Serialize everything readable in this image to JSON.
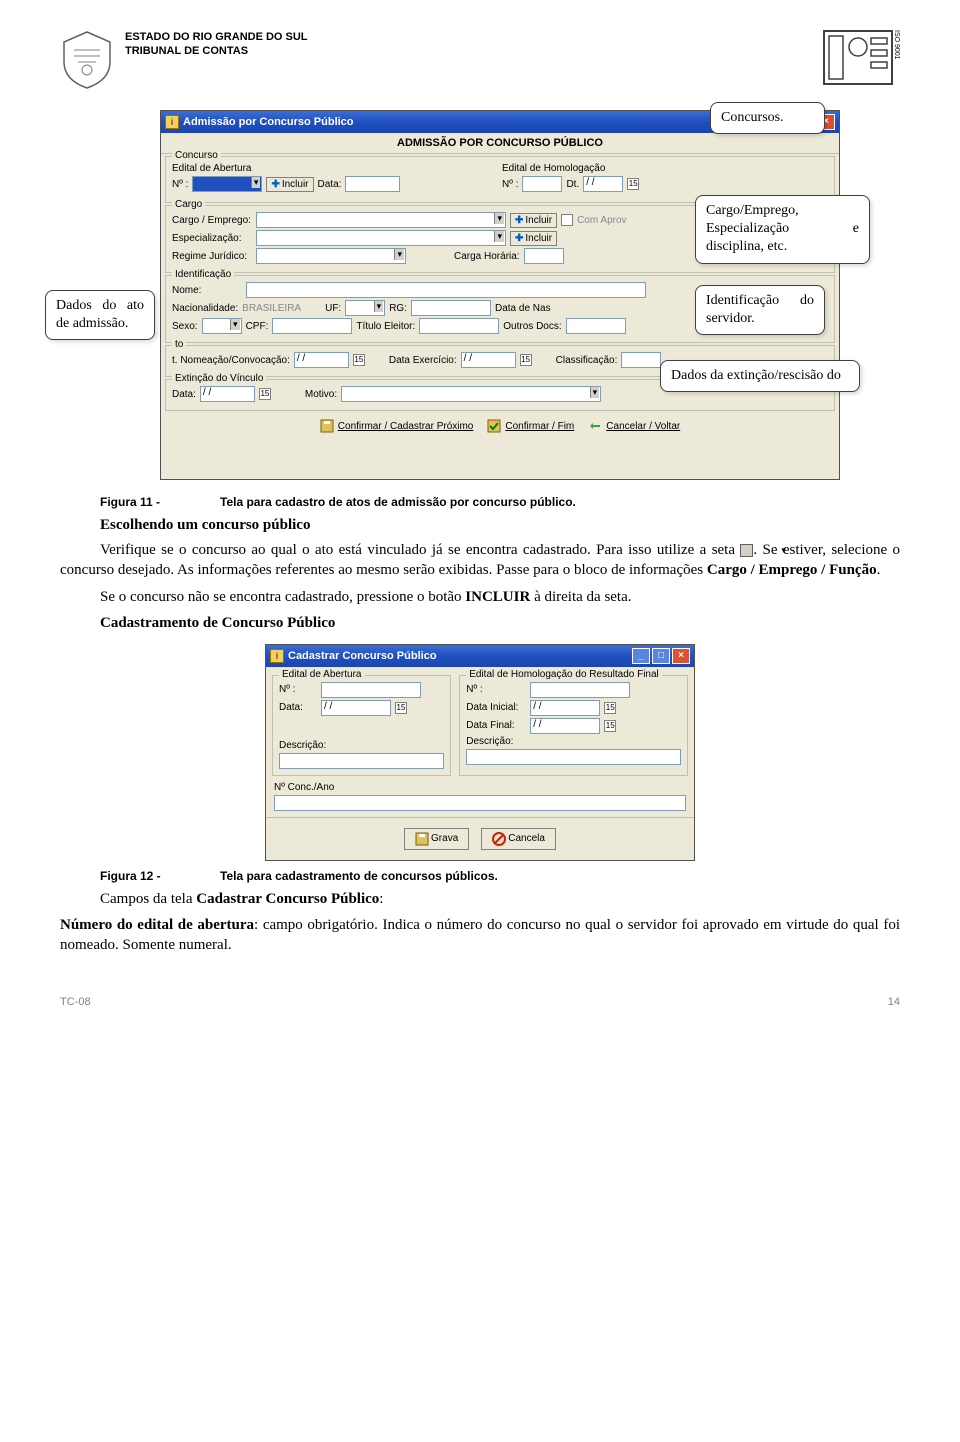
{
  "header": {
    "line1": "ESTADO DO RIO GRANDE DO SUL",
    "line2": "TRIBUNAL DE CONTAS",
    "iso": "ISO 9001"
  },
  "win1": {
    "title": "Admissão por Concurso Público",
    "heading": "ADMISSÃO POR CONCURSO PÚBLICO",
    "concurso_leg": "Concurso",
    "edital_abertura": "Edital de Abertura",
    "edital_homolog": "Edital de Homologação",
    "num_lbl": "Nº :",
    "incluir": "Incluir",
    "data_lbl": "Data:",
    "dt_lbl": "Dt.",
    "cargo_leg": "Cargo",
    "cargo_emprego": "Cargo / Emprego:",
    "especializacao": "Especialização:",
    "regime": "Regime Jurídico:",
    "carga": "Carga Horária:",
    "com_aprov": "Com Aprov",
    "ident_leg": "Identificação",
    "nome": "Nome:",
    "nacionalidade": "Nacionalidade:",
    "nacionalidade_val": "BRASILEIRA",
    "uf": "UF:",
    "rg": "RG:",
    "data_nasc": "Data de Nas",
    "sexo": "Sexo:",
    "cpf": "CPF:",
    "titulo": "Título Eleitor:",
    "outros": "Outros Docs:",
    "ato_leg": "to",
    "nomeacao": "t. Nomeação/Convocação:",
    "data_ex": "Data Exercício:",
    "classif": "Classificação:",
    "ext_leg": "Extinção do Vínculo",
    "ext_data": "Data:",
    "ext_motivo": "Motivo:",
    "btn_conf_prox": "Confirmar / Cadastrar Próximo",
    "btn_conf_fim": "Confirmar / Fim",
    "btn_cancel": "Cancelar / Voltar"
  },
  "callouts": {
    "c_concursos": "Concursos.",
    "c_cargo": "Cargo/Emprego, Especialização e disciplina, etc.",
    "c_dados_ato": "Dados do ato de admissão.",
    "c_ident": "Identificação do servidor.",
    "c_ext": "Dados da extinção/rescisão do"
  },
  "figure11": {
    "label": "Figura 11 -",
    "caption": "Tela para cadastro de atos de admissão por concurso público."
  },
  "text": {
    "h_escolhendo": "Escolhendo um concurso público",
    "p1a": "Verifique se o concurso ao qual o ato está vinculado já se encontra cadastrado. Para isso utilize a seta ",
    "p1b": ". Se estiver, selecione o concurso desejado. As informações referentes ao mesmo serão exibidas. Passe para o bloco de informações ",
    "p1c": "Cargo / Emprego / Função",
    "p1d": ".",
    "p2a": "Se o concurso não se encontra cadastrado, pressione o botão ",
    "p2b": "INCLUIR",
    "p2c": " à direita da seta.",
    "h_cadastramento": "Cadastramento de Concurso Público"
  },
  "win2": {
    "title": "Cadastrar Concurso Público",
    "leg_abertura": "Edital de Abertura",
    "leg_homolog": "Edital de Homologação do Resultado Final",
    "num": "Nº :",
    "data": "Data:",
    "data_inicial": "Data Inicial:",
    "data_final": "Data Final:",
    "descricao": "Descrição:",
    "conc_ano": "Nº Conc./Ano",
    "btn_grava": "Grava",
    "btn_cancela": "Cancela"
  },
  "figure12": {
    "label": "Figura 12 -",
    "caption": "Tela para cadastramento de concursos públicos."
  },
  "text2": {
    "p_campos_a": "Campos da tela ",
    "p_campos_b": "Cadastrar Concurso Público",
    "p_campos_c": ":",
    "p_num_a": "Número do edital de abertura",
    "p_num_b": ": campo obrigatório. Indica o número do concurso no qual o servidor foi aprovado em virtude do qual foi nomeado. Somente numeral."
  },
  "footer": {
    "doc": "TC-08",
    "page": "14"
  }
}
